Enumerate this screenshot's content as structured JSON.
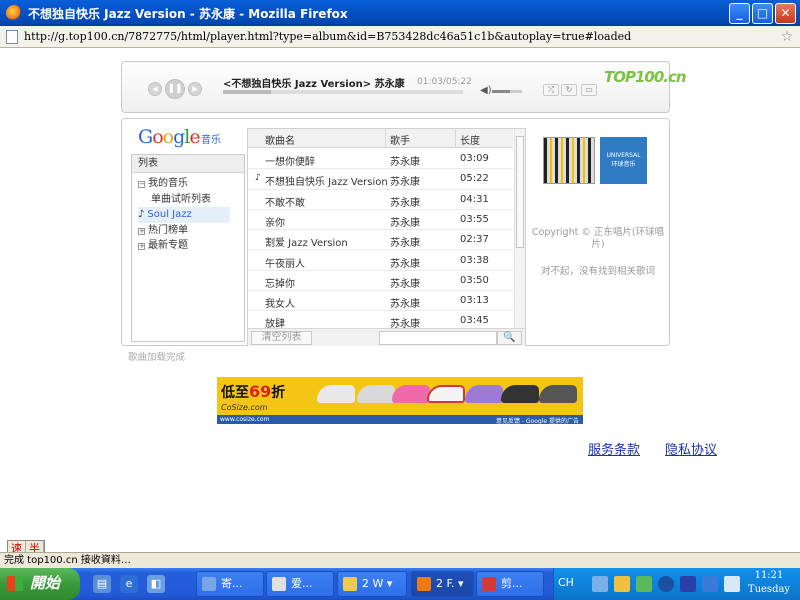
{
  "window": {
    "title": "不想独自快乐 Jazz Version - 苏永康 - Mozilla Firefox",
    "url": "http://g.top100.cn/7872775/html/player.html?type=album&id=B753428dc46a51c1b&autoplay=true#loaded"
  },
  "player": {
    "now_playing": "<不想独自快乐 Jazz Version> 苏永康",
    "time": "01:03/05:22",
    "progress": 0.2,
    "volume": 0.6,
    "logo": "TOP100.cn"
  },
  "brand": {
    "google": "Google",
    "music": "音乐"
  },
  "sidebar": {
    "header": "列表",
    "items": [
      {
        "label": "我的音乐",
        "marker": "−"
      },
      {
        "label": "单曲试听列表",
        "marker": ""
      },
      {
        "label": "Soul Jazz",
        "marker": "♪"
      },
      {
        "label": "热门榜单",
        "marker": "+"
      },
      {
        "label": "最新专题",
        "marker": "+"
      }
    ]
  },
  "songs": {
    "columns": {
      "name": "歌曲名",
      "artist": "歌手",
      "length": "长度"
    },
    "rows": [
      {
        "mark": "",
        "name": "一想你便醉",
        "artist": "苏永康",
        "length": "03:09"
      },
      {
        "mark": "♪",
        "name": "不想独自快乐 Jazz Version",
        "artist": "苏永康",
        "length": "05:22"
      },
      {
        "mark": "",
        "name": "不敢不敢",
        "artist": "苏永康",
        "length": "04:31"
      },
      {
        "mark": "",
        "name": "亲你",
        "artist": "苏永康",
        "length": "03:55"
      },
      {
        "mark": "",
        "name": "割爱 Jazz Version",
        "artist": "苏永康",
        "length": "02:37"
      },
      {
        "mark": "",
        "name": "午夜丽人",
        "artist": "苏永康",
        "length": "03:38"
      },
      {
        "mark": "",
        "name": "忘掉你",
        "artist": "苏永康",
        "length": "03:50"
      },
      {
        "mark": "",
        "name": "我女人",
        "artist": "苏永康",
        "length": "03:13"
      },
      {
        "mark": "",
        "name": "放肆",
        "artist": "苏永康",
        "length": "03:45"
      }
    ],
    "clear_label": "清空列表",
    "search_icon": "🔍"
  },
  "info": {
    "label_art": "UNIVERSAL\n环球音乐",
    "copyright": "Copyright © 正东唱片(环球唱片)",
    "no_lyrics": "对不起，没有找到相关歌词",
    "load_status": "歌曲加载完成"
  },
  "ad": {
    "text_prefix": "低至",
    "text_num": "69",
    "text_suffix": "折",
    "brand": "CoSize.com",
    "url": "www.cosize.com",
    "note": "意见反馈 - Google 提供的广告"
  },
  "footer": {
    "terms": "服务条款",
    "privacy": "隐私协议"
  },
  "ime": {
    "a": "速",
    "b": "半"
  },
  "status": "完成 top100.cn 接收資料…",
  "taskbar": {
    "start": "開始",
    "buttons": [
      {
        "label": "寄...",
        "color": "#7aa6e8"
      },
      {
        "label": "爱...",
        "color": "#e0e0e0"
      },
      {
        "label": "2 W ▾",
        "color": "#f2c94c"
      },
      {
        "label": "2 F. ▾",
        "color": "#f07a12"
      },
      {
        "label": "剪...",
        "color": "#d23a3a"
      }
    ],
    "ime_lang": "CH",
    "clock_time": "11:21",
    "clock_day": "Tuesday"
  }
}
